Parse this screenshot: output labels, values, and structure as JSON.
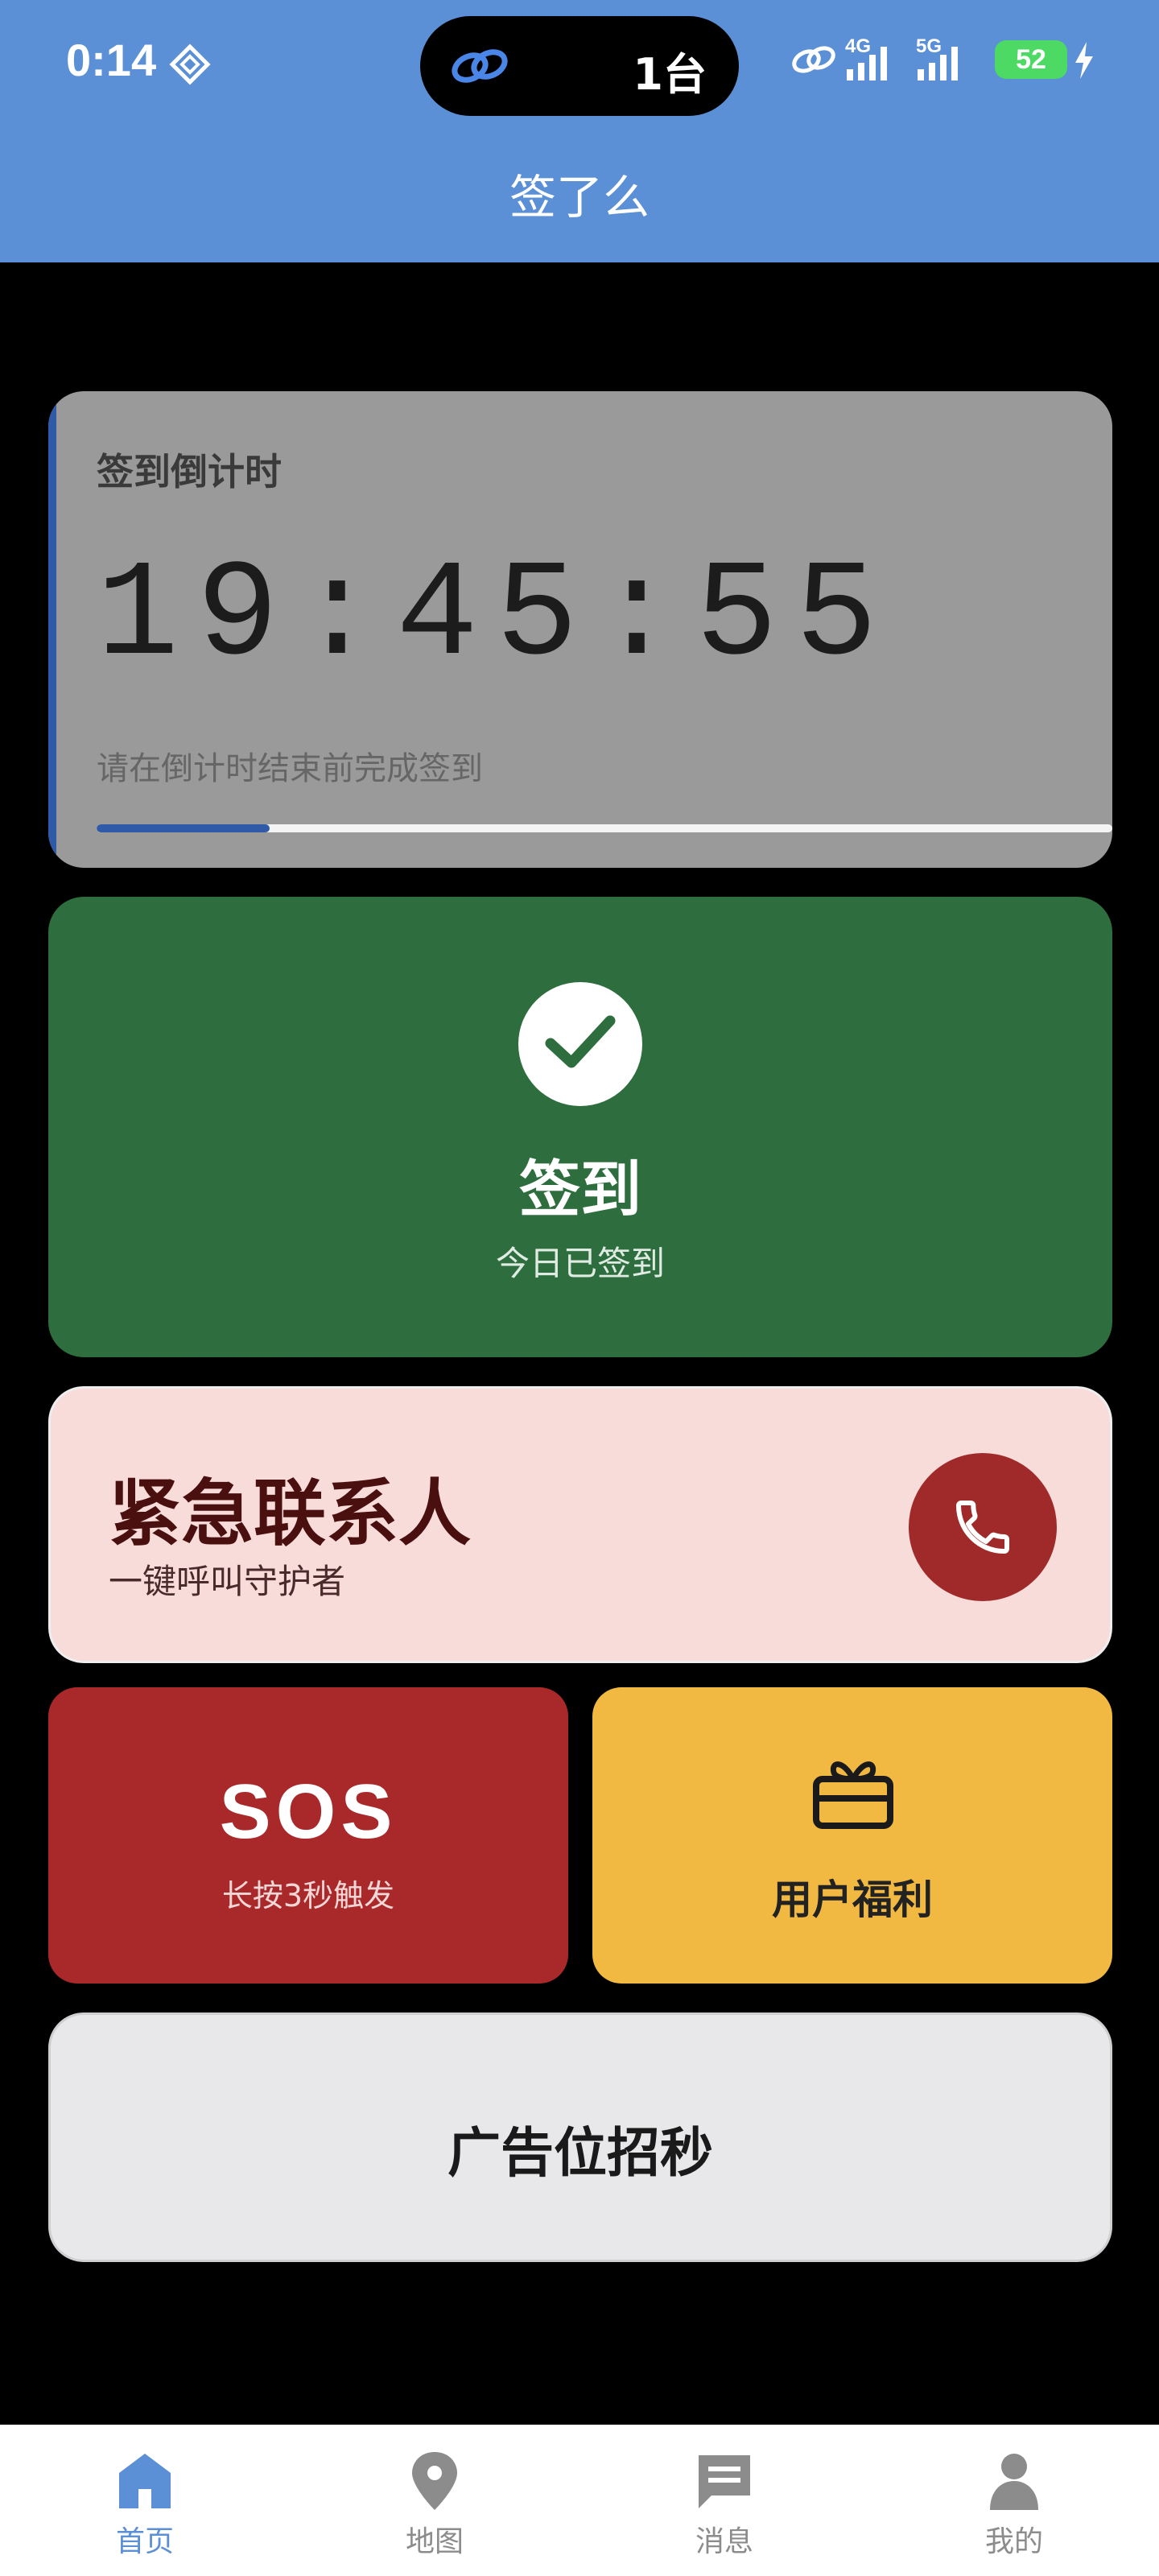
{
  "status_bar": {
    "time": "0:14",
    "island_text": "1台",
    "network_1": "4G",
    "network_2": "5G",
    "battery": "52"
  },
  "app": {
    "title": "签了么"
  },
  "countdown": {
    "title": "签到倒计时",
    "time": "19:45:55",
    "hint": "请在倒计时结束前完成签到",
    "progress": 0.17,
    "accent_color": "#2f5aa8"
  },
  "checkin": {
    "title": "签到",
    "status": "今日已签到",
    "color": "#2e6e3e"
  },
  "emergency": {
    "title": "紧急联系人",
    "subtitle": "一键呼叫守护者",
    "button_color": "#a02a2a"
  },
  "sos": {
    "title": "SOS",
    "subtitle": "长按3秒触发",
    "color": "#a9282a"
  },
  "benefits": {
    "title": "用户福利",
    "icon": "gift-icon",
    "color": "#f2b942"
  },
  "ad": {
    "title": "广告位招秒"
  },
  "nav": {
    "active_color": "#5b8fd6",
    "items": [
      {
        "label": "首页",
        "icon": "home-icon",
        "active": true
      },
      {
        "label": "地图",
        "icon": "map-pin-icon",
        "active": false
      },
      {
        "label": "消息",
        "icon": "message-icon",
        "active": false
      },
      {
        "label": "我的",
        "icon": "profile-icon",
        "active": false
      }
    ]
  }
}
